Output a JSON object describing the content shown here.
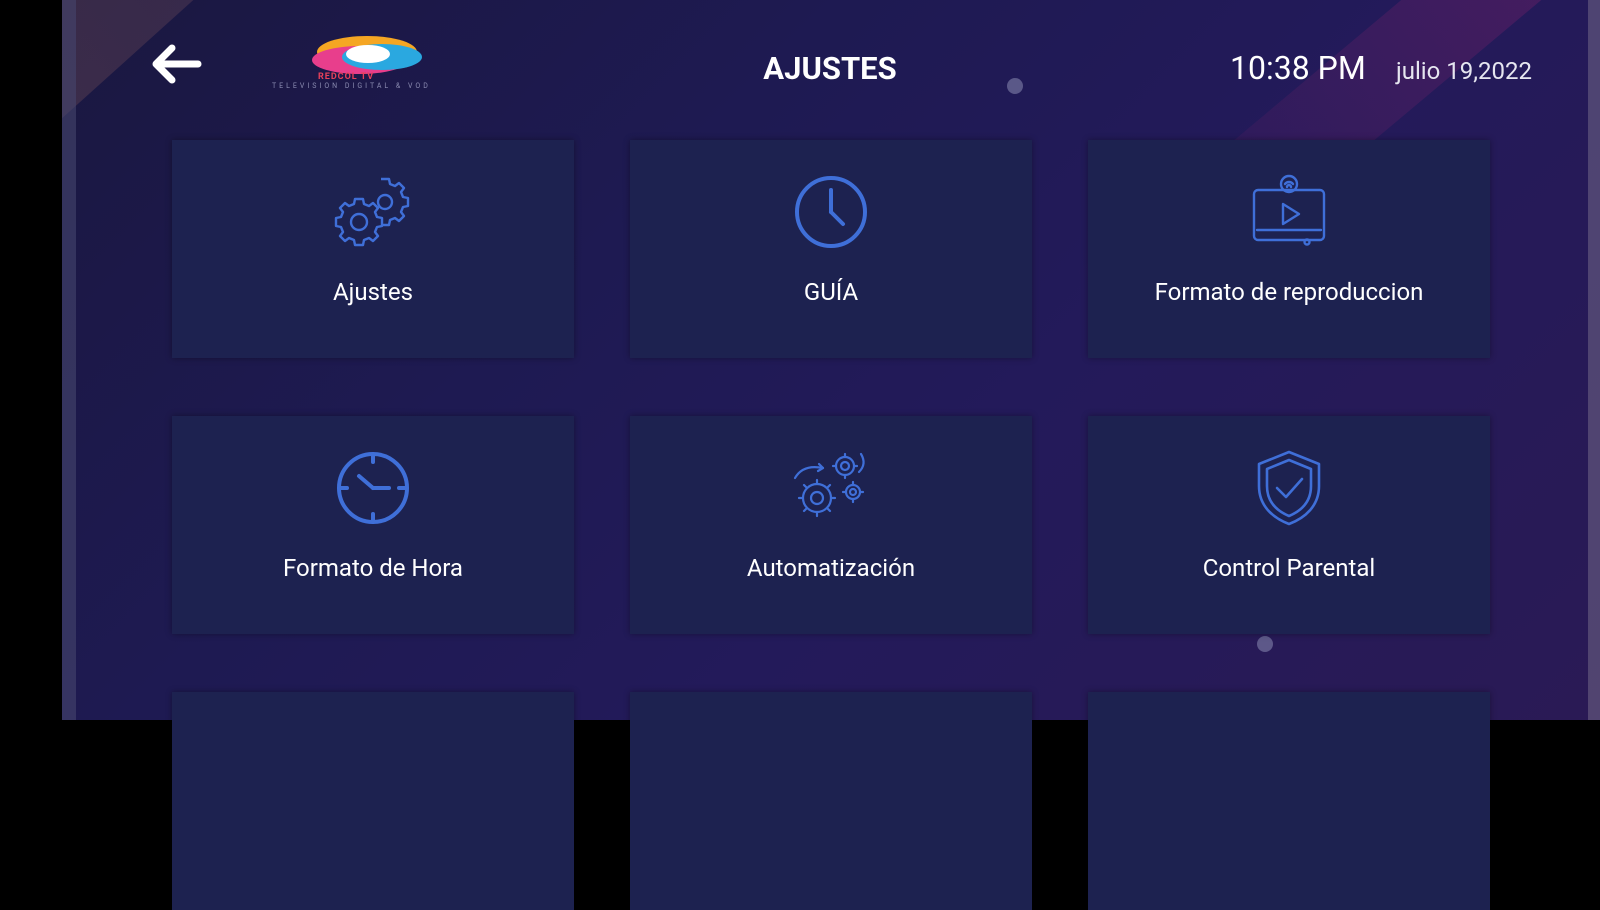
{
  "header": {
    "title": "AJUSTES",
    "time": "10:38 PM",
    "date": "julio 19,2022",
    "logo_brand": "REDCOL TV",
    "logo_tagline": "TELEVISION DIGITAL & VOD"
  },
  "colors": {
    "card_bg": "#1d2250",
    "icon": "#3f6fd8",
    "text": "#ffffff"
  },
  "cards": [
    {
      "label": "Ajustes",
      "icon": "gears-icon"
    },
    {
      "label": "GUÍA",
      "icon": "clock-icon"
    },
    {
      "label": "Formato de reproduccion",
      "icon": "video-player-icon"
    },
    {
      "label": "Formato de Hora",
      "icon": "stopwatch-icon"
    },
    {
      "label": "Automatización",
      "icon": "automation-gears-icon"
    },
    {
      "label": "Control Parental",
      "icon": "shield-check-icon"
    }
  ]
}
